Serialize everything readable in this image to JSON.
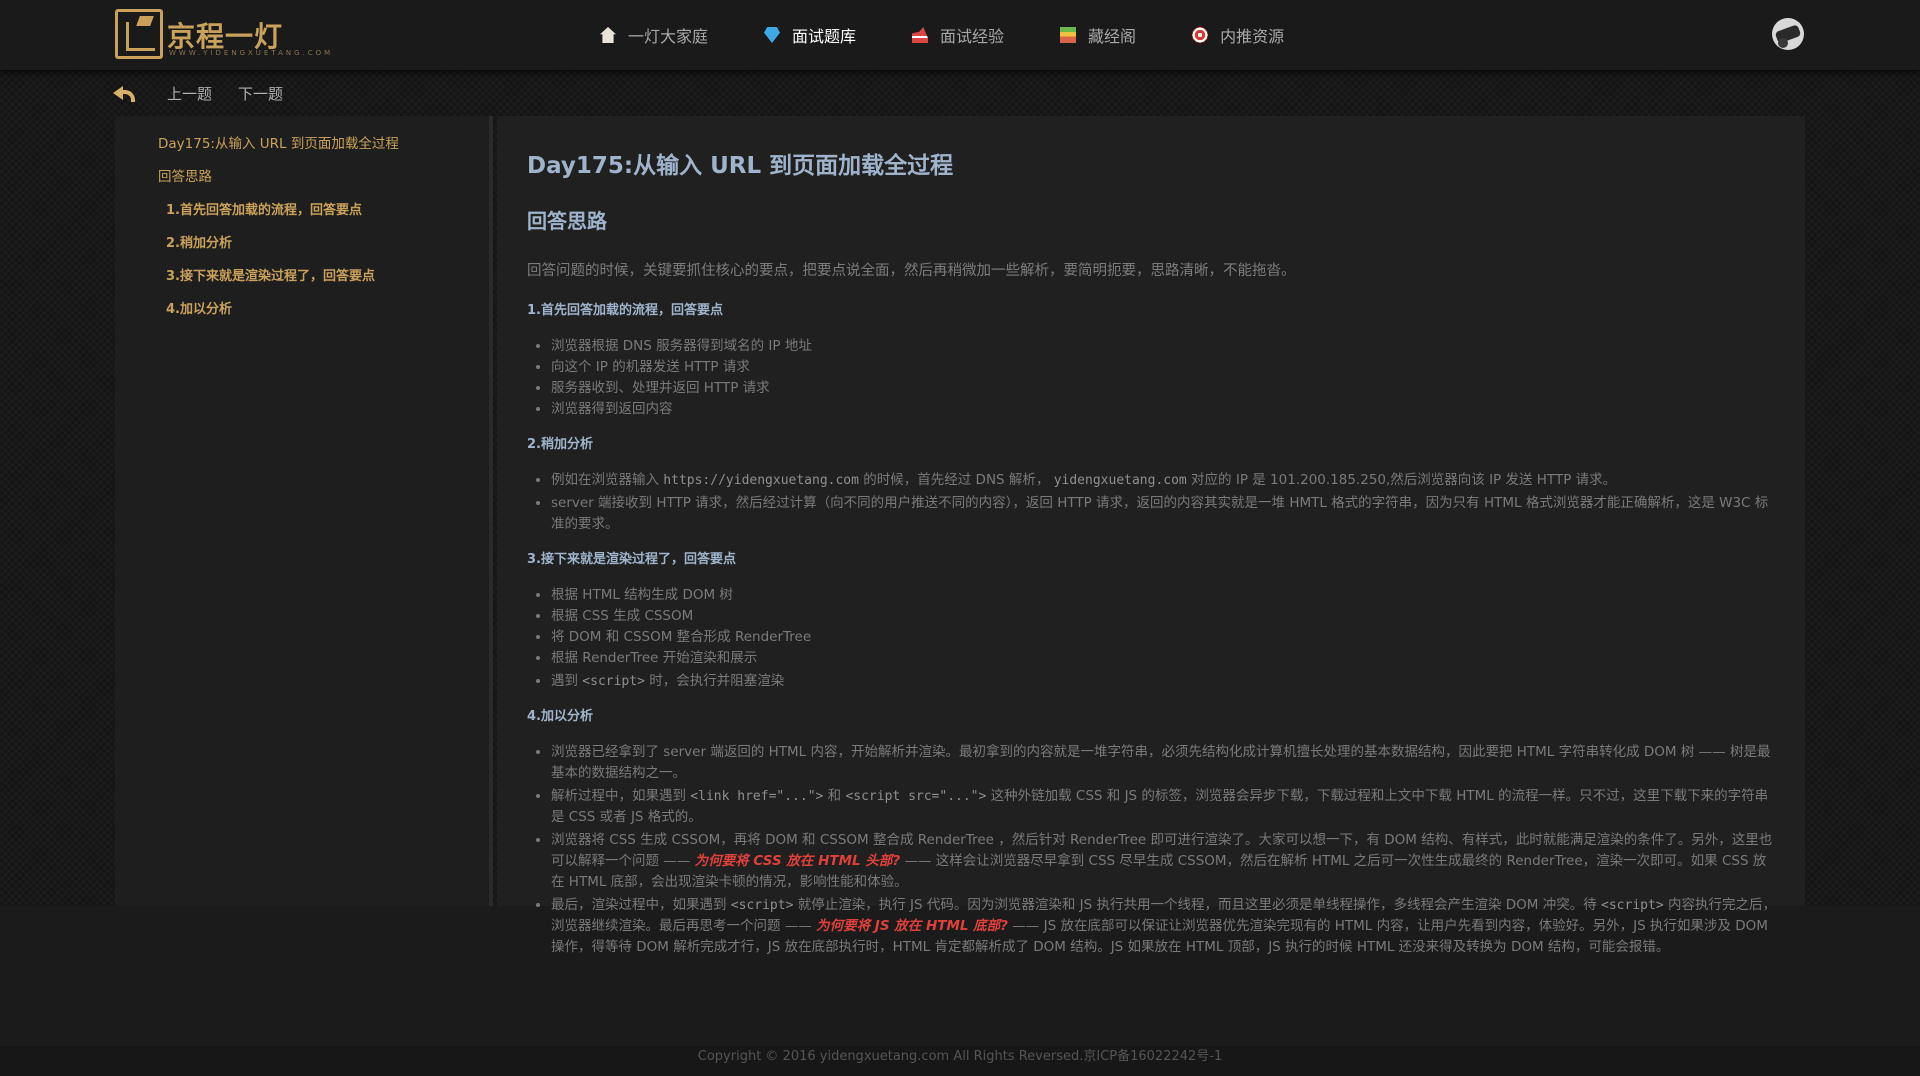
{
  "header": {
    "logo_text": "京程一灯",
    "logo_sub": "WWW.YIDENGXUETANG.COM",
    "nav": [
      {
        "label": "一灯大家庭",
        "icon": "home-icon",
        "active": false
      },
      {
        "label": "面试题库",
        "icon": "diamond-icon",
        "active": true
      },
      {
        "label": "面试经验",
        "icon": "shoe-icon",
        "active": false
      },
      {
        "label": "藏经阁",
        "icon": "books-icon",
        "active": false
      },
      {
        "label": "内推资源",
        "icon": "target-icon",
        "active": false
      }
    ]
  },
  "subnav": {
    "prev": "上一题",
    "next": "下一题"
  },
  "toc": [
    {
      "label": "Day175:从输入 URL 到页面加载全过程",
      "level": 1
    },
    {
      "label": "回答思路",
      "level": 1
    },
    {
      "label": "1.首先回答加载的流程，回答要点",
      "level": 2
    },
    {
      "label": "2.稍加分析",
      "level": 2
    },
    {
      "label": "3.接下来就是渲染过程了，回答要点",
      "level": 2
    },
    {
      "label": "4.加以分析",
      "level": 2
    }
  ],
  "article": {
    "title": "Day175:从输入 URL 到页面加载全过程",
    "subtitle": "回答思路",
    "intro": "回答问题的时候，关键要抓住核心的要点，把要点说全面，然后再稍微加一些解析，要简明扼要，思路清晰，不能拖沓。",
    "s1": {
      "title": "1.首先回答加载的流程，回答要点",
      "items": [
        "浏览器根据 DNS 服务器得到域名的 IP 地址",
        "向这个 IP 的机器发送 HTTP 请求",
        "服务器收到、处理并返回 HTTP 请求",
        "浏览器得到返回内容"
      ]
    },
    "s2": {
      "title": "2.稍加分析",
      "i1a": "例如在浏览器输入 ",
      "i1b": "https://yidengxuetang.com",
      "i1c": " 的时候，首先经过 DNS 解析， ",
      "i1d": "yidengxuetang.com",
      "i1e": " 对应的 IP 是 101.200.185.250,然后浏览器向该 IP 发送 HTTP 请求。",
      "i2": "server 端接收到 HTTP 请求，然后经过计算（向不同的用户推送不同的内容），返回 HTTP 请求，返回的内容其实就是一堆 HMTL 格式的字符串，因为只有 HTML 格式浏览器才能正确解析，这是 W3C 标准的要求。"
    },
    "s3": {
      "title": "3.接下来就是渲染过程了，回答要点",
      "items": [
        "根据 HTML 结构生成 DOM 树",
        "根据 CSS 生成 CSSOM",
        "将 DOM 和 CSSOM 整合形成 RenderTree",
        "根据 RenderTree 开始渲染和展示"
      ],
      "i5a": "遇到 ",
      "i5b": "<script>",
      "i5c": " 时，会执行并阻塞渲染"
    },
    "s4": {
      "title": "4.加以分析",
      "i1": "浏览器已经拿到了 server 端返回的 HTML 内容，开始解析并渲染。最初拿到的内容就是一堆字符串，必须先结构化成计算机擅长处理的基本数据结构，因此要把 HTML 字符串转化成 DOM 树 —— 树是最基本的数据结构之一。",
      "i2a": "解析过程中，如果遇到 ",
      "i2b": "<link href=\"...\">",
      "i2c": " 和 ",
      "i2d": "<script src=\"...\">",
      "i2e": " 这种外链加载 CSS 和 JS 的标签，浏览器会异步下载，下载过程和上文中下载 HTML 的流程一样。只不过，这里下载下来的字符串是 CSS 或者 JS 格式的。",
      "i3a": "浏览器将 CSS 生成 CSSOM，再将 DOM 和 CSSOM 整合成 RenderTree ，然后针对 RenderTree 即可进行渲染了。大家可以想一下，有 DOM 结构、有样式，此时就能满足渲染的条件了。另外，这里也可以解释一个问题 —— ",
      "i3b": "为何要将 CSS 放在 HTML 头部?",
      "i3c": " —— 这样会让浏览器尽早拿到 CSS 尽早生成 CSSOM，然后在解析 HTML 之后可一次性生成最终的 RenderTree，渲染一次即可。如果 CSS 放在 HTML 底部，会出现渲染卡顿的情况，影响性能和体验。",
      "i4a": "最后，渲染过程中，如果遇到 ",
      "i4b": "<script>",
      "i4c": " 就停止渲染，执行 JS 代码。因为浏览器渲染和 JS 执行共用一个线程，而且这里必须是单线程操作，多线程会产生渲染 DOM 冲突。待 ",
      "i4d": "<script>",
      "i4e": " 内容执行完之后，浏览器继续渲染。最后再思考一个问题 —— ",
      "i4f": "为何要将 JS 放在 HTML 底部?",
      "i4g": " —— JS 放在底部可以保证让浏览器优先渲染完现有的 HTML 内容，让用户先看到内容，体验好。另外，JS 执行如果涉及 DOM 操作，得等待 DOM 解析完成才行，JS 放在底部执行时，HTML 肯定都解析成了 DOM 结构。JS 如果放在 HTML 顶部，JS 执行的时候 HTML 还没来得及转换为 DOM 结构，可能会报错。"
    }
  },
  "footer": "Copyright © 2016 yidengxuetang.com All Rights Reversed.京ICP备16022242号-1"
}
